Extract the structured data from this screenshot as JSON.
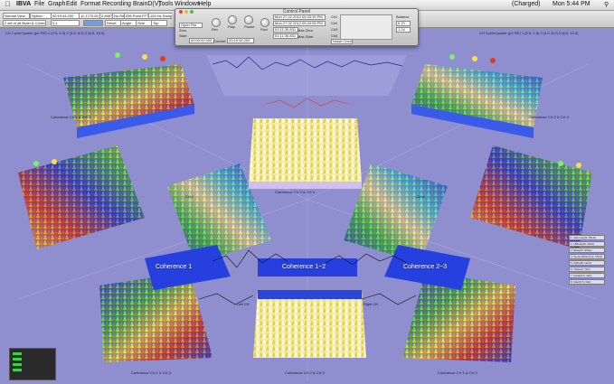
{
  "menubar": {
    "items": [
      "IBVA",
      "File",
      "Graph",
      "Edit",
      "Format",
      "Recording",
      "BrainD(V)",
      "Tools",
      "Windows",
      "Help"
    ],
    "status_charge": "(Charged)",
    "clock": "Mon 5:44 PM"
  },
  "toolbar": {
    "view_label": "Normal View",
    "option_label": "Option",
    "set_label": "2 set of all Brain & Coher...",
    "time_value": "00:19:44.200",
    "size1": "11.1770.00",
    "size2": "0.4667",
    "no_rec": "No Rec",
    "hz_value": "0.1",
    "reset_label": "Reset",
    "angle_label": "Angle",
    "side_label": "Side",
    "top_label": "Top",
    "fft_label": "256 Point FFT",
    "avg_label": "100 Hz Sample"
  },
  "control_panel": {
    "title": "Control Panel",
    "open_file": "Open File",
    "zero_label": "Zero",
    "start_label": "Start",
    "start_value": "00:00:00.000",
    "current_label": "Current",
    "current_value": "00:19:44.200",
    "knob_labels": [
      "Rev",
      "Play",
      "Pause",
      "Fwd"
    ],
    "date1": "Mon 27 02 2012 05:23:30 PM",
    "date2": "Mon 27 02 2012 05:44:05 PM",
    "max_zero_value": "01:11:30.831",
    "max_zero_label": "Max-Zero",
    "max_start_value": "01:11:30.831",
    "max_start_label": "Max-Start",
    "noise_check": "Noise Check",
    "balance_label": "Balance",
    "pct1": "0.70",
    "pct2": "1.24",
    "ch_labels": [
      "Ch1",
      "Ch2",
      "Ch3",
      "Ch4"
    ]
  },
  "panels": {
    "top_left_title": "CH 1 pixel power (µV RE) 1 (0.5, 4.0) 2 (3.5, 8.0) 3 (6.5, 15.0)",
    "top_right_title": "CH 4 pixel power (µV RE) 1 (0.5, 1.5) 2 (4.0, 8.0) 3 (6.0, 10.0)",
    "coherence_top_left": "Coherence CH 1 & CH 4",
    "coherence_top_right": "Coherence CH 2 & CH 4",
    "coherence_mid": "Coherence CH 3 & CH 4",
    "coherence_bottom_left": "Coherence CH 1 & CH 3",
    "coherence_bottom_mid": "Coherence CH 2 & CH 3",
    "coherence_bottom_right": "Coherence CH 1 & CH 2",
    "coh_1": "Coherence 1",
    "coh_12": "Coherence 1~2",
    "coh_23": "Coherence 2~3",
    "left_ch": "Left CH",
    "right_ch": "Right CH",
    "ch1_label": "CH 1",
    "ch4_label": "CH 4"
  },
  "legend": [
    "1. Gamma(41..50Hz)",
    "2. HiBeta(30..40Hz)",
    "3. Beta(13..30Hz)",
    "4. SensoriMotor(12..15Hz)",
    "5. Alpha(8..12Hz)",
    "6. Theta(4..7Hz)",
    "7. Delta(0.5..4Hz)",
    "8. Raw(0.5..3Hz)"
  ],
  "colors": {
    "background": "#8f8fd0",
    "surface_blue": "#1a3bd8",
    "surface_yellow": "#f5e24a",
    "surface_red": "#e23a1c",
    "surface_green": "#35c84a"
  }
}
